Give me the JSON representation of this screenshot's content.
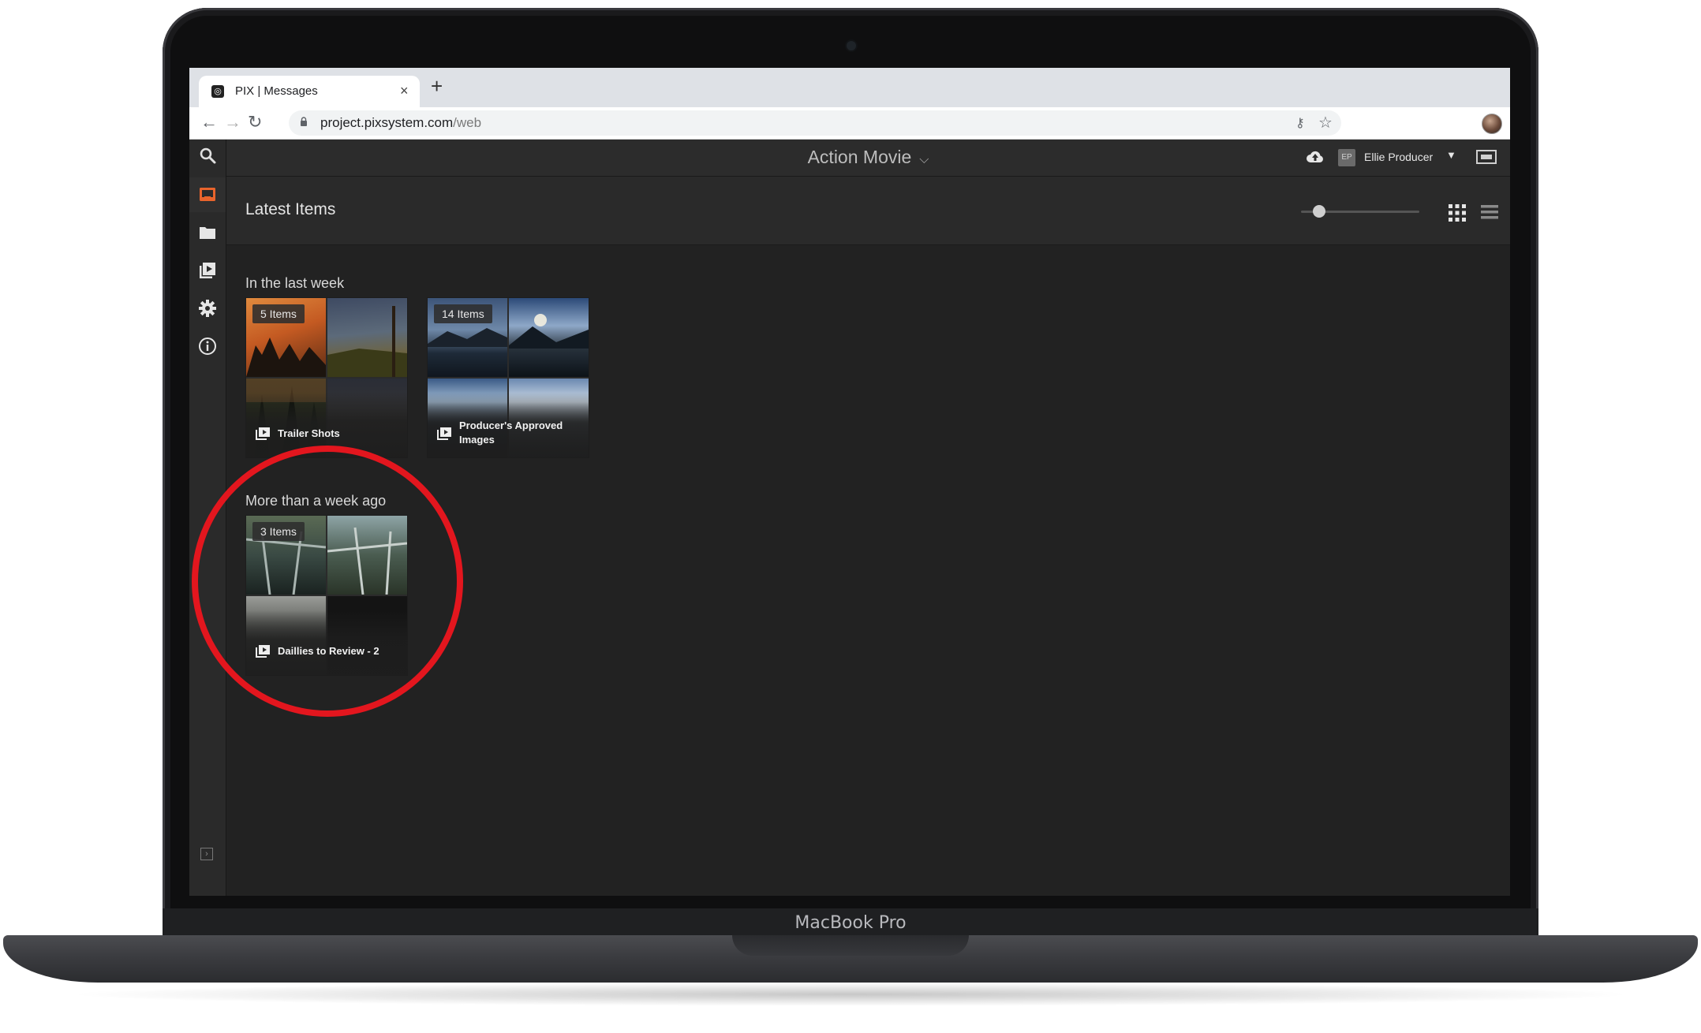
{
  "device": {
    "brand_label": "MacBook Pro"
  },
  "browser": {
    "tab": {
      "favicon": "pix-logo-icon",
      "title": "PIX | Messages",
      "close_glyph": "×"
    },
    "new_tab_glyph": "+",
    "nav": {
      "back": "←",
      "forward": "→",
      "reload": "↻"
    },
    "url": {
      "host": "project.pixsystem.com",
      "path": "/web"
    },
    "key_glyph": "⚷",
    "star_glyph": "☆"
  },
  "app": {
    "project_title": "Action Movie",
    "project_caret": "⌵",
    "user": {
      "initials": "EP",
      "name": "Ellie Producer",
      "caret": "▼"
    },
    "page_title": "Latest Items",
    "zoom_slider": {
      "value": 0.15
    },
    "sidebar": {
      "items": [
        "search-icon",
        "inbox-icon",
        "folder-icon",
        "playlist-icon",
        "gear-icon",
        "info-icon"
      ],
      "active": "inbox-icon",
      "collapse_glyph": "›"
    },
    "sections": [
      {
        "title": "In the last week",
        "cards": [
          {
            "count": "5 Items",
            "name": "Trailer Shots",
            "type": "playlist"
          },
          {
            "count": "14 Items",
            "name": "Producer's Approved Images",
            "type": "playlist"
          }
        ]
      },
      {
        "title": "More than a week ago",
        "cards": [
          {
            "count": "3 Items",
            "name": "Daillies to Review - 2",
            "type": "playlist"
          }
        ]
      }
    ],
    "accent_color": "#e8642c",
    "highlight_color": "#e3161e"
  }
}
